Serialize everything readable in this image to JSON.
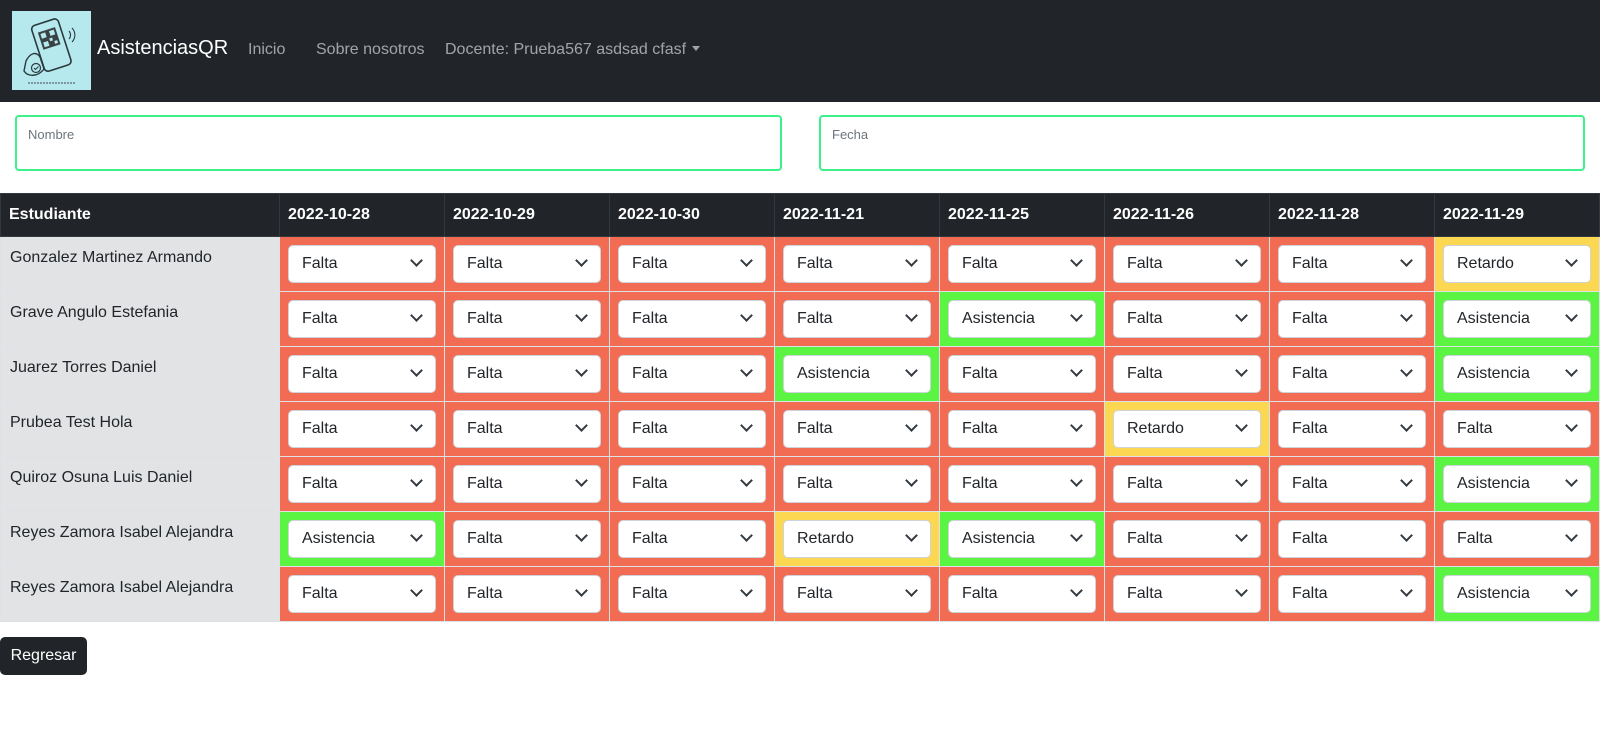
{
  "navbar": {
    "brand": "AsistenciasQR",
    "links": [
      {
        "label": "Inicio"
      },
      {
        "label": "Sobre nosotros"
      },
      {
        "label": "Docente: Prueba567 asdsad cfasf"
      }
    ]
  },
  "filters": {
    "nombre": {
      "label": "Nombre",
      "value": ""
    },
    "fecha": {
      "label": "Fecha",
      "value": ""
    }
  },
  "table": {
    "header": [
      "Estudiante",
      "2022-10-28",
      "2022-10-29",
      "2022-10-30",
      "2022-11-21",
      "2022-11-25",
      "2022-11-26",
      "2022-11-28",
      "2022-11-29"
    ],
    "rows": [
      {
        "student": "Gonzalez Martinez Armando",
        "values": [
          "Falta",
          "Falta",
          "Falta",
          "Falta",
          "Falta",
          "Falta",
          "Falta",
          "Retardo"
        ]
      },
      {
        "student": "Grave Angulo Estefania",
        "values": [
          "Falta",
          "Falta",
          "Falta",
          "Falta",
          "Asistencia",
          "Falta",
          "Falta",
          "Asistencia"
        ]
      },
      {
        "student": "Juarez Torres Daniel",
        "values": [
          "Falta",
          "Falta",
          "Falta",
          "Asistencia",
          "Falta",
          "Falta",
          "Falta",
          "Asistencia"
        ]
      },
      {
        "student": "Prubea Test Hola",
        "values": [
          "Falta",
          "Falta",
          "Falta",
          "Falta",
          "Falta",
          "Retardo",
          "Falta",
          "Falta"
        ]
      },
      {
        "student": "Quiroz Osuna Luis Daniel",
        "values": [
          "Falta",
          "Falta",
          "Falta",
          "Falta",
          "Falta",
          "Falta",
          "Falta",
          "Asistencia"
        ]
      },
      {
        "student": "Reyes Zamora Isabel Alejandra",
        "values": [
          "Asistencia",
          "Falta",
          "Falta",
          "Retardo",
          "Asistencia",
          "Falta",
          "Falta",
          "Falta"
        ]
      },
      {
        "student": "Reyes Zamora Isabel Alejandra",
        "values": [
          "Falta",
          "Falta",
          "Falta",
          "Falta",
          "Falta",
          "Falta",
          "Falta",
          "Asistencia"
        ]
      }
    ]
  },
  "status_colors": {
    "Falta": "#f26c53",
    "Asistencia": "#5cf443",
    "Retardo": "#fbd752"
  },
  "back_button": "Regresar"
}
